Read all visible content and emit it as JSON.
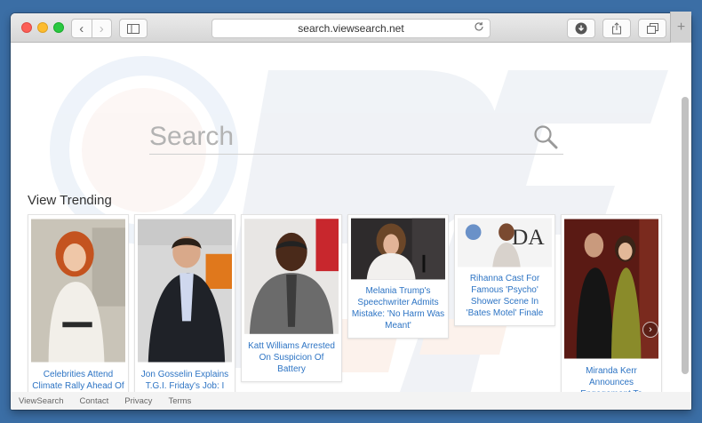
{
  "browser": {
    "url": "search.viewsearch.net",
    "back_glyph": "‹",
    "forward_glyph": "›",
    "new_tab_glyph": "+"
  },
  "search": {
    "placeholder": "Search"
  },
  "trending": {
    "title": "View Trending",
    "cards": [
      {
        "caption": "Celebrities Attend Climate Rally Ahead Of The Democratic National Convention"
      },
      {
        "caption": "Jon Gosselin Explains T.G.I. Friday's Job: I Love To Cook"
      },
      {
        "caption": "Katt Williams Arrested On Suspicion Of Battery"
      },
      {
        "caption": "Melania Trump's Speechwriter Admits Mistake: 'No Harm Was Meant'"
      },
      {
        "caption": "Rihanna Cast For Famous 'Psycho' Shower Scene In 'Bates Motel' Finale"
      },
      {
        "caption": "Miranda Kerr Announces Engagement To Snapchat Founder Evan Spiegel – See The Ring!"
      }
    ]
  },
  "footer": {
    "links": [
      "ViewSearch",
      "Contact",
      "Privacy",
      "Terms"
    ]
  },
  "colors": {
    "link": "#2d74c4",
    "desktop": "#3b6ea5"
  }
}
